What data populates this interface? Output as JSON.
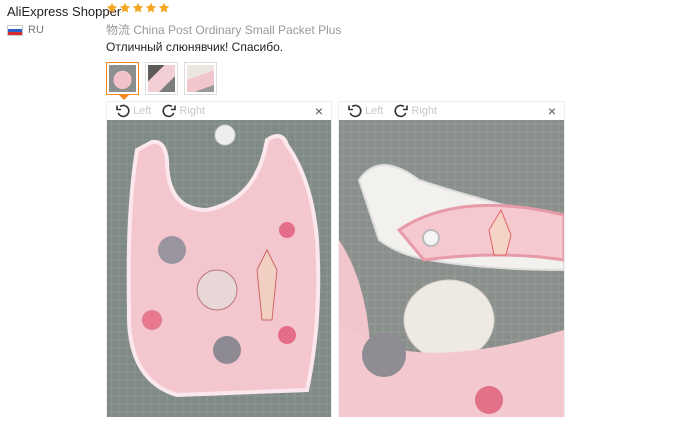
{
  "review": {
    "user_name": "AliExpress Shopper",
    "rating": 5,
    "country_code": "RU",
    "shipping": "物流 China Post Ordinary Small Packet Plus",
    "feedback": "Отличный слюнявчик! Спасибо."
  },
  "thumbnails": [
    {
      "label": "photo-1",
      "selected": true
    },
    {
      "label": "photo-2",
      "selected": false
    },
    {
      "label": "photo-3",
      "selected": false
    }
  ],
  "viewers": [
    {
      "rotate_left_label": "Left",
      "rotate_right_label": "Right",
      "close_label": "×"
    },
    {
      "rotate_left_label": "Left",
      "rotate_right_label": "Right",
      "close_label": "×"
    }
  ],
  "colors": {
    "star": "#f5a623",
    "accent": "#f28a20",
    "bib_pink": "#f4c7cf",
    "blanket_gray": "#7f8a86"
  }
}
